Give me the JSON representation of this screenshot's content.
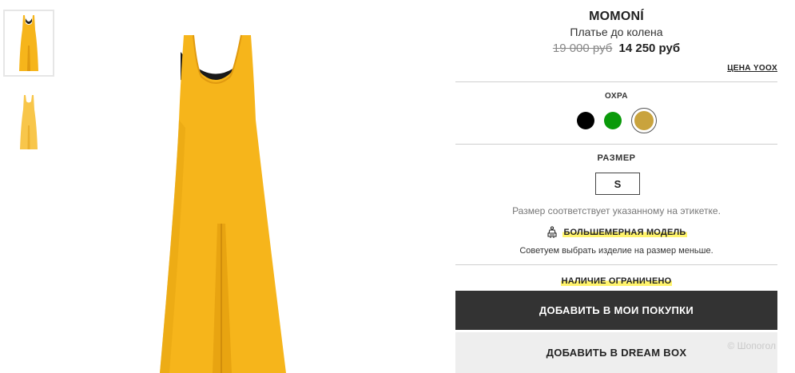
{
  "product": {
    "brand": "MOMONÍ",
    "name": "Платье до колена",
    "price_old": "19 000 руб",
    "price_new": "14 250 руб",
    "price_link": "ЦЕНА YOOX"
  },
  "color": {
    "label": "ОХРА",
    "swatches": [
      {
        "name": "black",
        "hex": "#000000"
      },
      {
        "name": "green",
        "hex": "#0a9a0a"
      },
      {
        "name": "ochre",
        "hex": "#c9a33d",
        "selected": true
      }
    ]
  },
  "size": {
    "label": "РАЗМЕР",
    "selected": "S",
    "note": "Размер соответствует указанному на этикетке."
  },
  "fit": {
    "title": "БОЛЬШЕМЕРНАЯ МОДЕЛЬ",
    "note": "Советуем выбрать изделие на размер меньше.",
    "icon": "dress-form-icon"
  },
  "availability": "НАЛИЧИЕ ОГРАНИЧЕНО",
  "buttons": {
    "add_to_cart": "ДОБАВИТЬ В МОИ ПОКУПКИ",
    "dream_box": "ДОБАВИТЬ В DREAM BOX"
  },
  "watermark": "© Шопогол",
  "colors": {
    "dress": "#f6b51b",
    "dress_shade": "#e09a10",
    "primary_button": "#333333",
    "highlight": "#fff36b"
  }
}
